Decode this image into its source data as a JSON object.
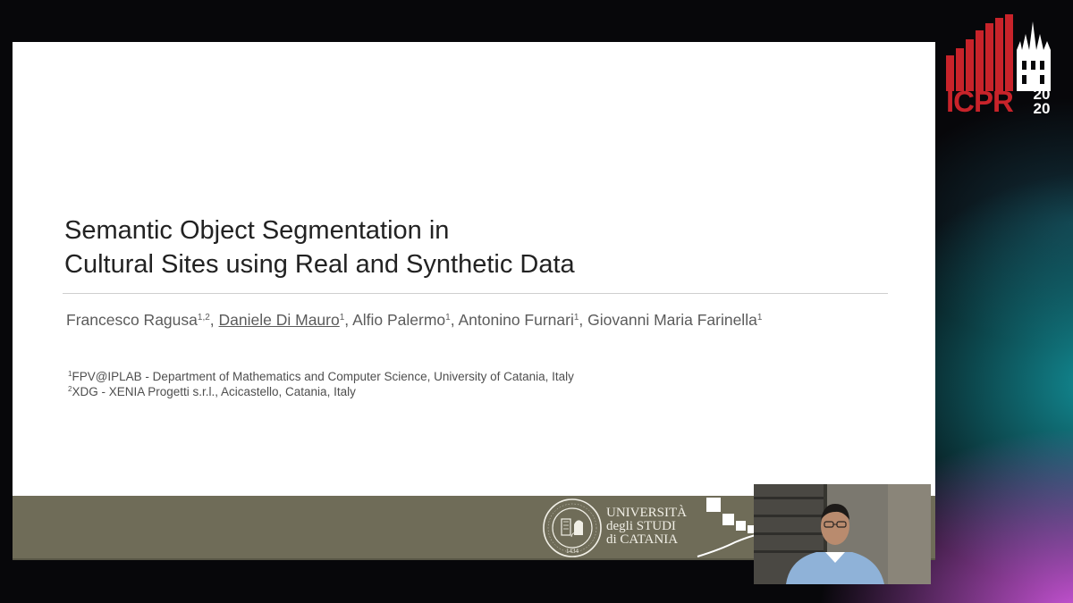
{
  "slide": {
    "title_lines": [
      "Semantic Object Segmentation in",
      "Cultural Sites using Real and Synthetic Data"
    ],
    "authors": [
      {
        "name": "Francesco Ragusa",
        "sup": "1,2",
        "sep": ", "
      },
      {
        "name": "Daniele Di Mauro",
        "sup": "1",
        "sep": ", "
      },
      {
        "name": "Alfio Palermo",
        "sup": "1",
        "sep": ", "
      },
      {
        "name": "Antonino Furnari",
        "sup": "1",
        "sep": ", "
      },
      {
        "name": "Giovanni Maria Farinella",
        "sup": "1",
        "sep": ""
      }
    ],
    "affiliations": [
      {
        "sup": "1",
        "text": "FPV@IPLAB - Department of Mathematics and Computer Science, University of Catania, Italy"
      },
      {
        "sup": "2",
        "text": "XDG - XENIA Progetti s.r.l., Acicastello, Catania, Italy"
      }
    ],
    "university_lines": [
      "UNIVERSITÀ",
      "degli STUDI",
      "di CATANIA"
    ],
    "seal_year": "1434"
  },
  "conference_logo": {
    "text": "ICPR",
    "year_lines": [
      "20",
      "20"
    ]
  },
  "icons": {
    "seal": "university-seal-icon",
    "squares": "iplab-squares-logo-icon",
    "skyline": "milan-cathedral-skyline-icon"
  },
  "colors": {
    "footer_band": "#6f6c58",
    "logo_red": "#c8232a",
    "slide_bg": "#ffffff"
  }
}
